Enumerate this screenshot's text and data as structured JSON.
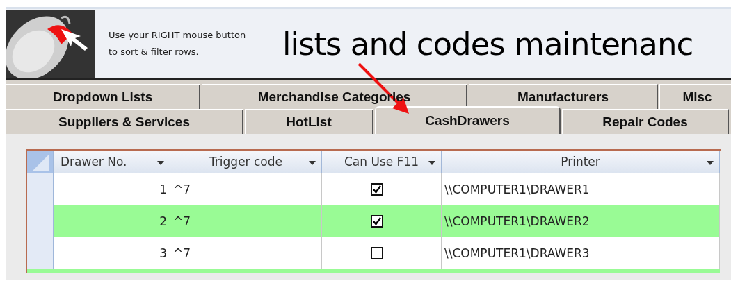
{
  "header": {
    "hint": "Use your RIGHT mouse button to sort & filter  rows.",
    "title": "lists and codes maintenanc"
  },
  "tab_rows": [
    [
      {
        "label": "Dropdown Lists",
        "selected": false
      },
      {
        "label": "Merchandise Categories",
        "selected": false
      },
      {
        "label": "Manufacturers",
        "selected": false
      },
      {
        "label": "Misc",
        "selected": false
      }
    ],
    [
      {
        "label": "Suppliers & Services",
        "selected": false
      },
      {
        "label": "HotList",
        "selected": false
      },
      {
        "label": "CashDrawers",
        "selected": true
      },
      {
        "label": "Repair Codes",
        "selected": false
      }
    ]
  ],
  "table": {
    "columns": [
      "Drawer No.",
      "Trigger code",
      "Can Use F11",
      "Printer"
    ],
    "rows": [
      {
        "drawer_no": "1",
        "trigger_code": "^7",
        "can_use_f11": true,
        "printer": "\\\\COMPUTER1\\DRAWER1",
        "highlighted": false
      },
      {
        "drawer_no": "2",
        "trigger_code": "^7",
        "can_use_f11": true,
        "printer": "\\\\COMPUTER1\\DRAWER2",
        "highlighted": true
      },
      {
        "drawer_no": "3",
        "trigger_code": "^7",
        "can_use_f11": false,
        "printer": "\\\\COMPUTER1\\DRAWER3",
        "highlighted": false
      }
    ]
  }
}
